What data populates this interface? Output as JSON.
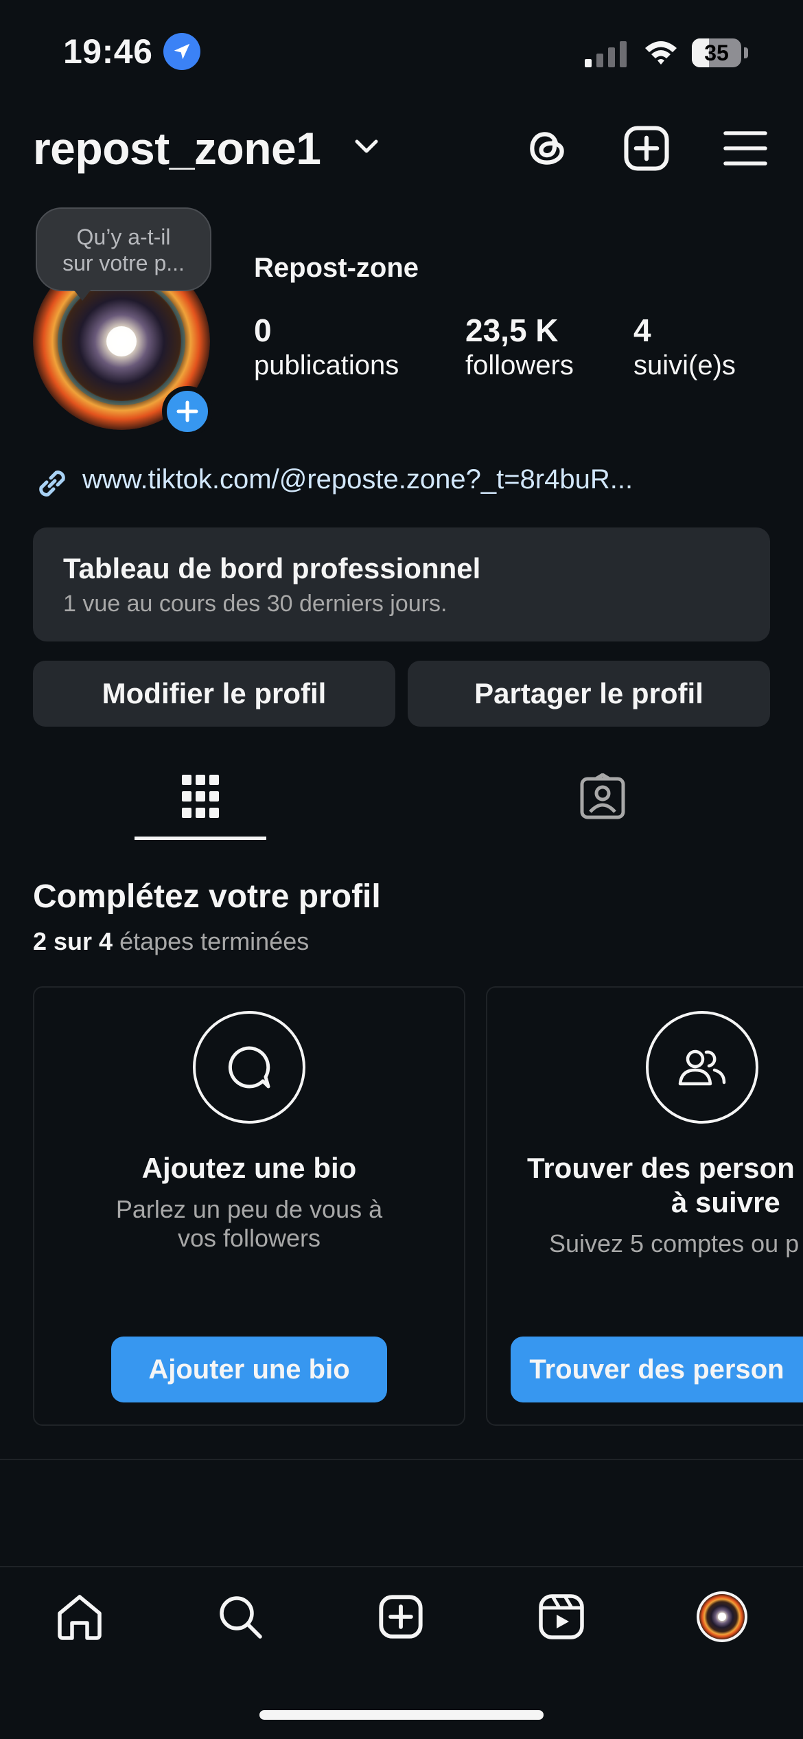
{
  "status_bar": {
    "time": "19:46",
    "battery": "35",
    "battery_level": 0.35
  },
  "header": {
    "username": "repost_zone1"
  },
  "profile": {
    "bubble_line1": "Qu’y a-t-il",
    "bubble_line2": "sur votre p...",
    "display_name": "Repost-zone",
    "stats": [
      {
        "value": "0",
        "label": "publications"
      },
      {
        "value": "23,5 K",
        "label": "followers"
      },
      {
        "value": "4",
        "label": "suivi(e)s"
      }
    ],
    "link": "www.tiktok.com/@reposte.zone?_t=8r4buR..."
  },
  "dashboard": {
    "title": "Tableau de bord professionnel",
    "subtitle": "1 vue au cours des 30 derniers jours."
  },
  "actions": {
    "edit": "Modifier le profil",
    "share": "Partager le profil"
  },
  "complete": {
    "title": "Complétez votre profil",
    "progress_bold": "2 sur 4",
    "progress_rest": "étapes terminées",
    "cards": [
      {
        "icon": "chat-bubble-icon",
        "title": "Ajoutez une bio",
        "desc_line1": "Parlez un peu de vous à",
        "desc_line2": "vos followers",
        "button": "Ajouter une bio"
      },
      {
        "icon": "people-icon",
        "title_line1": "Trouver des person",
        "title_line2": "à suivre",
        "desc": "Suivez 5 comptes ou p",
        "button": "Trouver des person"
      }
    ]
  },
  "colors": {
    "background": "#0c1014",
    "accent": "#3797f0",
    "surface": "#25292e"
  }
}
